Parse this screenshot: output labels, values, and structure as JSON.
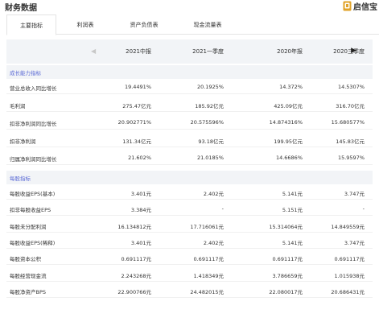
{
  "page_title": "财务数据",
  "brand": {
    "name": "启信宝",
    "icon": "brand-logo-icon",
    "color": "#c98a1a"
  },
  "tabs": [
    {
      "label": "主要指标",
      "active": true
    },
    {
      "label": "利润表",
      "active": false
    },
    {
      "label": "资产负债表",
      "active": false
    },
    {
      "label": "现金流量表",
      "active": false
    }
  ],
  "table": {
    "columns": [
      "2021中报",
      "2021一季度",
      "2020年报",
      "2020三季度"
    ],
    "nav": {
      "prev_icon": "chevron-left-icon",
      "next_icon": "chevron-right-icon"
    },
    "sections": [
      {
        "title": "成长能力指标",
        "rows": [
          {
            "label": "营业总收入同比增长",
            "values": [
              "19.4491%",
              "20.1925%",
              "14.372%",
              "14.5307%"
            ]
          },
          {
            "label": "毛利润",
            "values": [
              "275.47亿元",
              "185.92亿元",
              "425.09亿元",
              "316.70亿元"
            ]
          },
          {
            "label": "扣非净利润同比增长",
            "values": [
              "20.902771%",
              "20.575596%",
              "14.874316%",
              "15.680577%"
            ]
          },
          {
            "label": "扣非净利润",
            "values": [
              "131.34亿元",
              "93.18亿元",
              "199.95亿元",
              "145.83亿元"
            ]
          },
          {
            "label": "归属净利润同比增长",
            "values": [
              "21.602%",
              "21.0185%",
              "14.6686%",
              "15.9597%"
            ]
          }
        ]
      },
      {
        "title": "每股指标",
        "rows": [
          {
            "label": "每股收益EPS(基本)",
            "values": [
              "3.401元",
              "2.402元",
              "5.141元",
              "3.747元"
            ]
          },
          {
            "label": "扣非每股收益EPS",
            "values": [
              "3.384元",
              "-",
              "5.151元",
              "-"
            ]
          },
          {
            "label": "每股未分配利润",
            "values": [
              "16.134812元",
              "17.716061元",
              "15.314064元",
              "14.849559元"
            ]
          },
          {
            "label": "每股收益EPS(稀释)",
            "values": [
              "3.401元",
              "2.402元",
              "5.141元",
              "3.747元"
            ]
          },
          {
            "label": "每股资本公积",
            "values": [
              "0.691117元",
              "0.691117元",
              "0.691117元",
              "0.691117元"
            ]
          },
          {
            "label": "每股经营现金流",
            "values": [
              "2.243268元",
              "1.418349元",
              "3.786659元",
              "1.015938元"
            ]
          },
          {
            "label": "每股净资产BPS",
            "values": [
              "22.900766元",
              "24.482015元",
              "22.080017元",
              "20.686431元"
            ]
          }
        ]
      }
    ]
  }
}
